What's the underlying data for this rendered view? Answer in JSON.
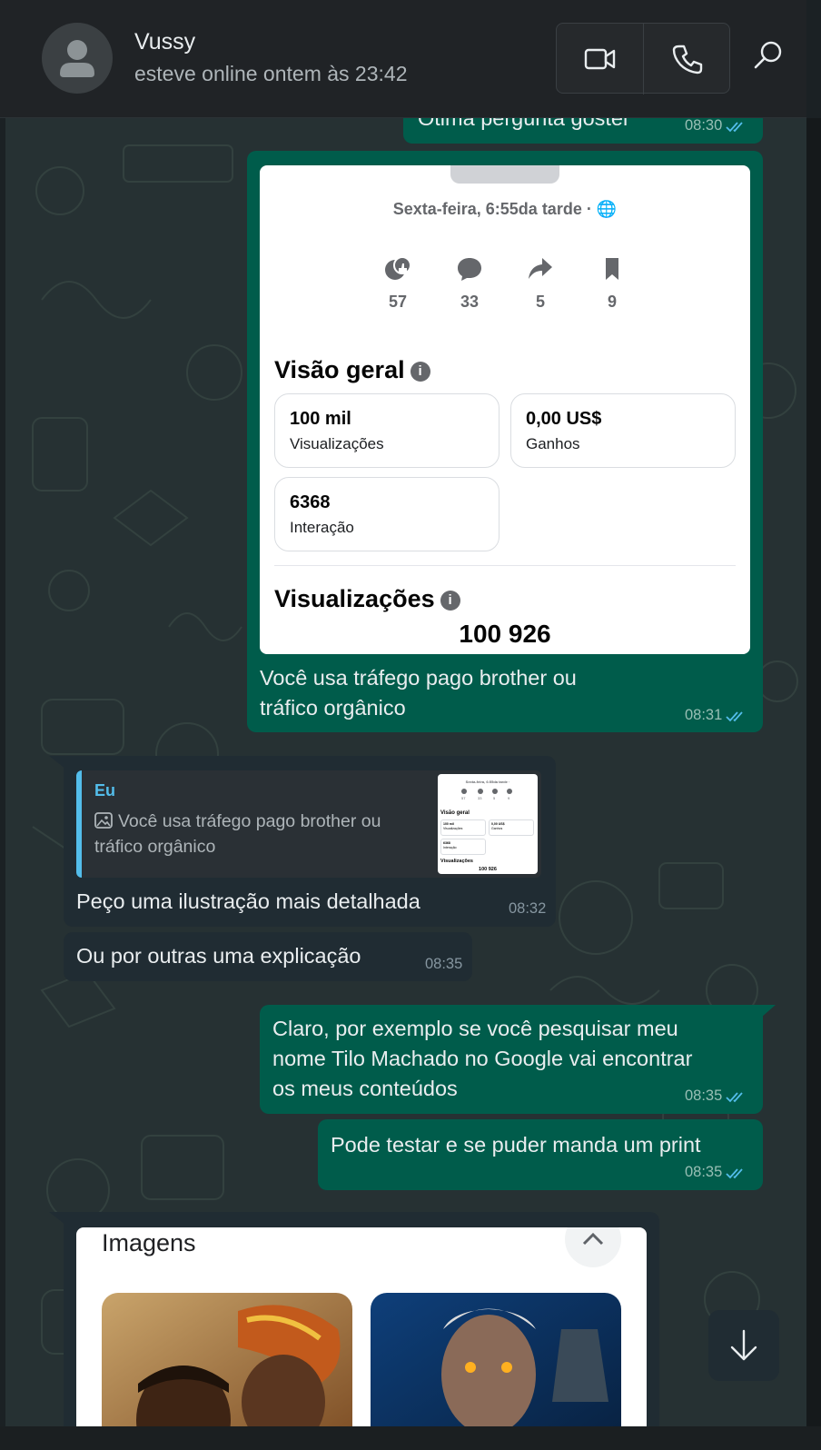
{
  "header": {
    "contact_name": "Vussy",
    "status": "esteve online ontem às 23:42",
    "icons": {
      "avatar": "person-icon",
      "video": "video-call-icon",
      "voice": "phone-icon",
      "search": "search-icon"
    }
  },
  "messages": {
    "m0": {
      "text": "Ótima pergunta gostei",
      "time": "08:30"
    },
    "m1": {
      "caption_line1": "Você usa tráfego pago brother ou",
      "caption_line2": "tráfico orgânico",
      "time": "08:31",
      "card": {
        "date": "Sexta-feira, 6:55da tarde · 🌐",
        "stats": {
          "likes": "57",
          "comments": "33",
          "shares": "5",
          "saves": "9"
        },
        "overview_title": "Visão geral",
        "tiles": [
          {
            "value": "100 mil",
            "label": "Visualizações"
          },
          {
            "value": "0,00 US$",
            "label": "Ganhos"
          },
          {
            "value": "6368",
            "label": "Interação"
          }
        ],
        "views_title": "Visualizações",
        "views_value": "100 926"
      }
    },
    "m2": {
      "quote_author": "Eu",
      "quote_text": "Você usa tráfego pago brother ou tráfico orgânico",
      "text": "Peço uma ilustração mais detalhada",
      "time": "08:32",
      "thumb": {
        "date": "Sexta-feira, 6:55da tarde ·",
        "stats": [
          "57",
          "33",
          "5",
          "9"
        ],
        "overview": "Visão geral",
        "t1v": "100 mil",
        "t1l": "Visualizações",
        "t2v": "0,00 US$",
        "t2l": "Ganhos",
        "t3v": "6368",
        "t3l": "Interação",
        "views": "Visualizações",
        "views_value": "100 926"
      }
    },
    "m3": {
      "text": "Ou por outras uma explicação",
      "time": "08:35"
    },
    "m4": {
      "line1": "Claro, por exemplo se você pesquisar meu",
      "line2": "nome Tilo Machado no Google vai encontrar",
      "line3": "os meus conteúdos",
      "time": "08:35"
    },
    "m5": {
      "text": "Pode testar e se puder manda um print",
      "time": "08:35"
    },
    "m6": {
      "card_title": "Imagens"
    }
  },
  "colors": {
    "outgoing_bubble": "#005c4b",
    "incoming_bubble": "#202c33",
    "read_ticks": "#53bdeb",
    "quote_accent": "#53bdeb"
  }
}
